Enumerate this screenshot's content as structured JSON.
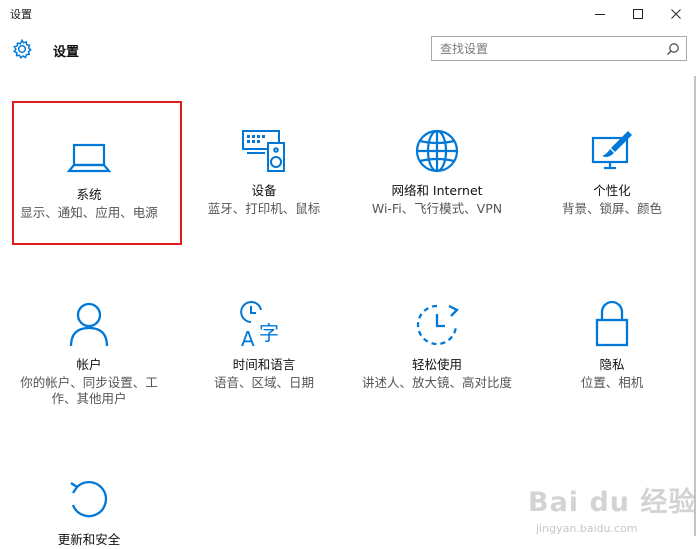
{
  "window": {
    "title": "设置",
    "controls": [
      "minimize-icon",
      "maximize-icon",
      "close-icon"
    ]
  },
  "header": {
    "title": "设置",
    "icon": "gear-icon"
  },
  "search": {
    "placeholder": "查找设置",
    "icon": "search-icon"
  },
  "accent_color": "#0078d7",
  "highlight_color": "#e21b1b",
  "tiles": [
    {
      "label": "系统",
      "desc": "显示、通知、应用、电源",
      "icon": "laptop-icon"
    },
    {
      "label": "设备",
      "desc": "蓝牙、打印机、鼠标",
      "icon": "devices-icon"
    },
    {
      "label": "网络和 Internet",
      "desc": "Wi-Fi、飞行模式、VPN",
      "icon": "globe-icon"
    },
    {
      "label": "个性化",
      "desc": "背景、锁屏、颜色",
      "icon": "personalization-icon"
    },
    {
      "label": "帐户",
      "desc": "你的帐户、同步设置、工作、其他用户",
      "icon": "person-icon"
    },
    {
      "label": "时间和语言",
      "desc": "语音、区域、日期",
      "icon": "time-language-icon"
    },
    {
      "label": "轻松使用",
      "desc": "讲述人、放大镜、高对比度",
      "icon": "ease-of-access-icon"
    },
    {
      "label": "隐私",
      "desc": "位置、相机",
      "icon": "lock-icon"
    },
    {
      "label": "更新和安全",
      "desc": "",
      "icon": "update-icon"
    }
  ],
  "watermark": {
    "text": "Bai du 经验",
    "sub": "jingyan.baidu.com"
  }
}
